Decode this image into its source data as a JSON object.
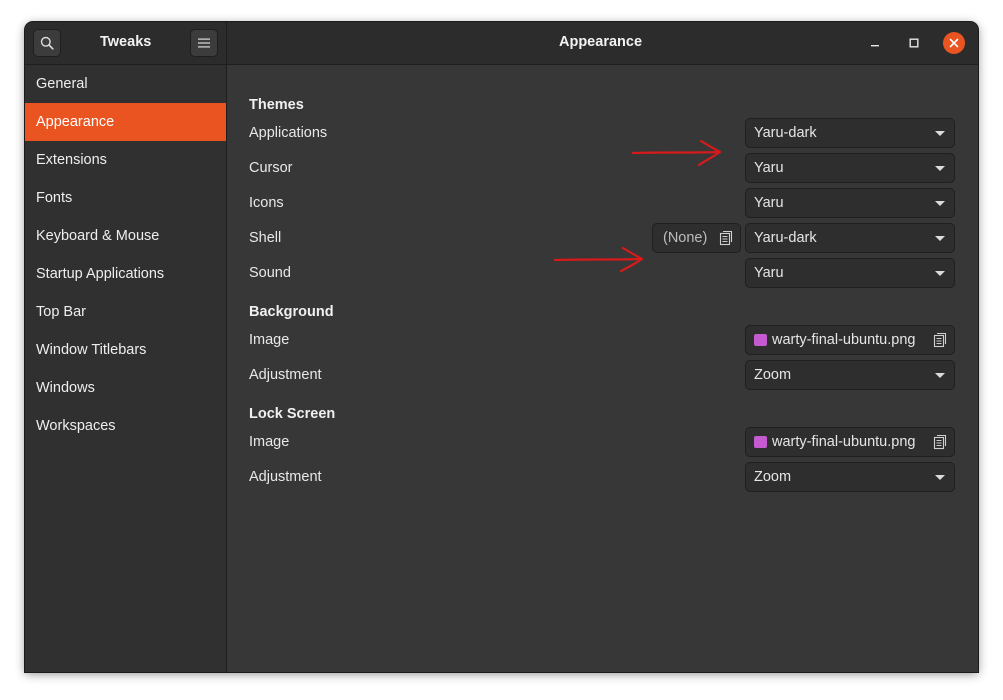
{
  "app": {
    "title": "Tweaks",
    "page_title": "Appearance"
  },
  "colors": {
    "accent": "#e95420",
    "annotation": "#d81a1a"
  },
  "icons": {
    "search": "search-icon",
    "menu": "hamburger-menu-icon",
    "minimize": "minimize-icon",
    "maximize": "maximize-icon",
    "close": "close-icon",
    "image": "image-file-icon",
    "document": "document-icon",
    "dropdown": "chevron-down-icon"
  },
  "sidebar": {
    "items": [
      {
        "label": "General"
      },
      {
        "label": "Appearance",
        "active": true
      },
      {
        "label": "Extensions"
      },
      {
        "label": "Fonts"
      },
      {
        "label": "Keyboard & Mouse"
      },
      {
        "label": "Startup Applications"
      },
      {
        "label": "Top Bar"
      },
      {
        "label": "Window Titlebars"
      },
      {
        "label": "Windows"
      },
      {
        "label": "Workspaces"
      }
    ]
  },
  "themes": {
    "title": "Themes",
    "applications": {
      "label": "Applications",
      "value": "Yaru-dark"
    },
    "cursor": {
      "label": "Cursor",
      "value": "Yaru"
    },
    "icons": {
      "label": "Icons",
      "value": "Yaru"
    },
    "shell": {
      "label": "Shell",
      "file_value": "(None)",
      "value": "Yaru-dark"
    },
    "sound": {
      "label": "Sound",
      "value": "Yaru"
    }
  },
  "background": {
    "title": "Background",
    "image": {
      "label": "Image",
      "value": "warty-final-ubuntu.png"
    },
    "adjustment": {
      "label": "Adjustment",
      "value": "Zoom"
    }
  },
  "lock_screen": {
    "title": "Lock Screen",
    "image": {
      "label": "Image",
      "value": "warty-final-ubuntu.png"
    },
    "adjustment": {
      "label": "Adjustment",
      "value": "Zoom"
    }
  }
}
